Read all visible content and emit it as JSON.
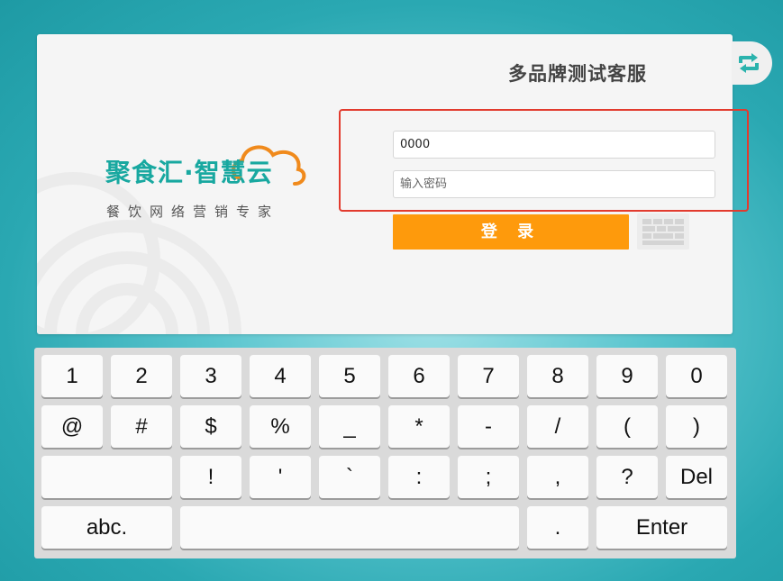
{
  "store": {
    "title": "多品牌测试客服"
  },
  "logo": {
    "name": "聚食汇·智慧云",
    "tagline": "餐饮网络营销专家",
    "icon": "cloud-icon"
  },
  "login": {
    "account_value": "0000",
    "password_placeholder": "输入密码",
    "login_label": "登 录"
  },
  "icons": {
    "refresh": "refresh-icon",
    "keyboard": "keyboard-icon"
  },
  "colors": {
    "accent": "#fe9a0c",
    "brand": "#18a8a0",
    "highlight": "#e23b2e"
  },
  "keyboard": {
    "row1": [
      "1",
      "2",
      "3",
      "4",
      "5",
      "6",
      "7",
      "8",
      "9",
      "0"
    ],
    "row2": [
      "@",
      "#",
      "$",
      "%",
      "_",
      "*",
      "-",
      "/",
      "(",
      ")"
    ],
    "row3": [
      "",
      "!",
      "'",
      "`",
      ":",
      ";",
      ",",
      "?",
      "Del"
    ],
    "row4": [
      "abc.",
      "",
      ".",
      "Enter"
    ]
  }
}
